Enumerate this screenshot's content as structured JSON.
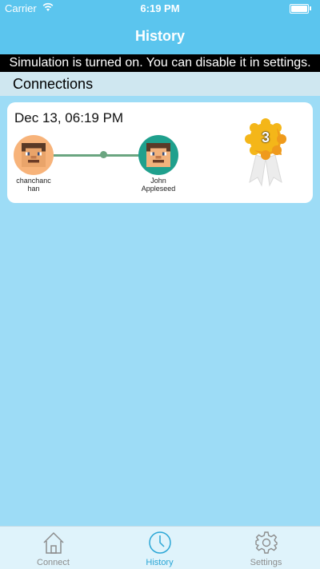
{
  "status_bar": {
    "carrier": "Carrier",
    "time": "6:19 PM",
    "wifi_icon": "wifi-icon",
    "battery_icon": "battery-icon"
  },
  "nav": {
    "title": "History"
  },
  "banner": {
    "text": "Simulation is turned on. You can disable it in settings."
  },
  "section": {
    "title": "Connections"
  },
  "connections": [
    {
      "date": "Dec 13, 06:19 PM",
      "user_a": "chanchanc\nhan",
      "user_b": "John\nAppleseed",
      "badge_count": "3"
    }
  ],
  "tabs": [
    {
      "label": "Connect",
      "icon": "house-icon",
      "active": false
    },
    {
      "label": "History",
      "icon": "clock-icon",
      "active": true
    },
    {
      "label": "Settings",
      "icon": "gear-icon",
      "active": false
    }
  ],
  "colors": {
    "nav_bg": "#5bc5ee",
    "page_bg": "#9ddcf6",
    "active_tab": "#2aa6d6",
    "inactive_tab": "#8c8c8c",
    "connection_line": "#6aa580"
  }
}
